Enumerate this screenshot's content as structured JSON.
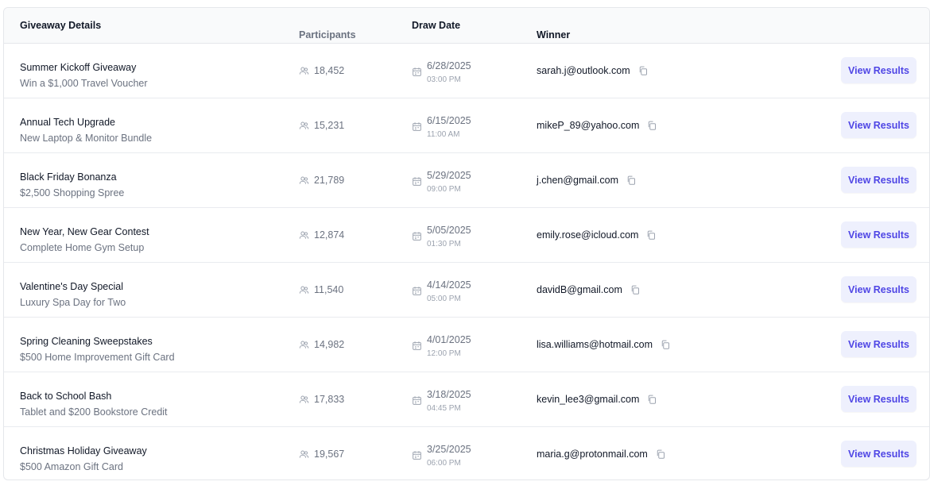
{
  "headers": {
    "details": "Giveaway Details",
    "participants": "Participants",
    "date": "Draw Date",
    "winner": "Winner"
  },
  "colors": {
    "accent": "#4f46e5",
    "button_bg": "#eef0fd",
    "muted": "#6b7280"
  },
  "icons": {
    "participants": "users-icon",
    "date": "calendar-icon",
    "winner_copy": "copy-icon"
  },
  "rows": [
    {
      "title": "Summer Kickoff Giveaway",
      "subtitle": "Win a $1,000 Travel Voucher",
      "participants": "18,452",
      "date": "6/28/2025",
      "time": "03:00 PM",
      "winner": "sarah.j@outlook.com",
      "action": "View Results"
    },
    {
      "title": "Annual Tech Upgrade",
      "subtitle": "New Laptop & Monitor Bundle",
      "participants": "15,231",
      "date": "6/15/2025",
      "time": "11:00 AM",
      "winner": "mikeP_89@yahoo.com",
      "action": "View Results"
    },
    {
      "title": "Black Friday Bonanza",
      "subtitle": "$2,500 Shopping Spree",
      "participants": "21,789",
      "date": "5/29/2025",
      "time": "09:00 PM",
      "winner": "j.chen@gmail.com",
      "action": "View Results"
    },
    {
      "title": "New Year, New Gear Contest",
      "subtitle": "Complete Home Gym Setup",
      "participants": "12,874",
      "date": "5/05/2025",
      "time": "01:30 PM",
      "winner": "emily.rose@icloud.com",
      "action": "View Results"
    },
    {
      "title": "Valentine's Day Special",
      "subtitle": "Luxury Spa Day for Two",
      "participants": "11,540",
      "date": "4/14/2025",
      "time": "05:00 PM",
      "winner": "davidB@gmail.com",
      "action": "View Results"
    },
    {
      "title": "Spring Cleaning Sweepstakes",
      "subtitle": "$500 Home Improvement Gift Card",
      "participants": "14,982",
      "date": "4/01/2025",
      "time": "12:00 PM",
      "winner": "lisa.williams@hotmail.com",
      "action": "View Results"
    },
    {
      "title": "Back to School Bash",
      "subtitle": "Tablet and $200 Bookstore Credit",
      "participants": "17,833",
      "date": "3/18/2025",
      "time": "04:45 PM",
      "winner": "kevin_lee3@gmail.com",
      "action": "View Results"
    },
    {
      "title": "Christmas Holiday Giveaway",
      "subtitle": "$500 Amazon Gift Card",
      "participants": "19,567",
      "date": "3/25/2025",
      "time": "06:00 PM",
      "winner": "maria.g@protonmail.com",
      "action": "View Results"
    }
  ]
}
